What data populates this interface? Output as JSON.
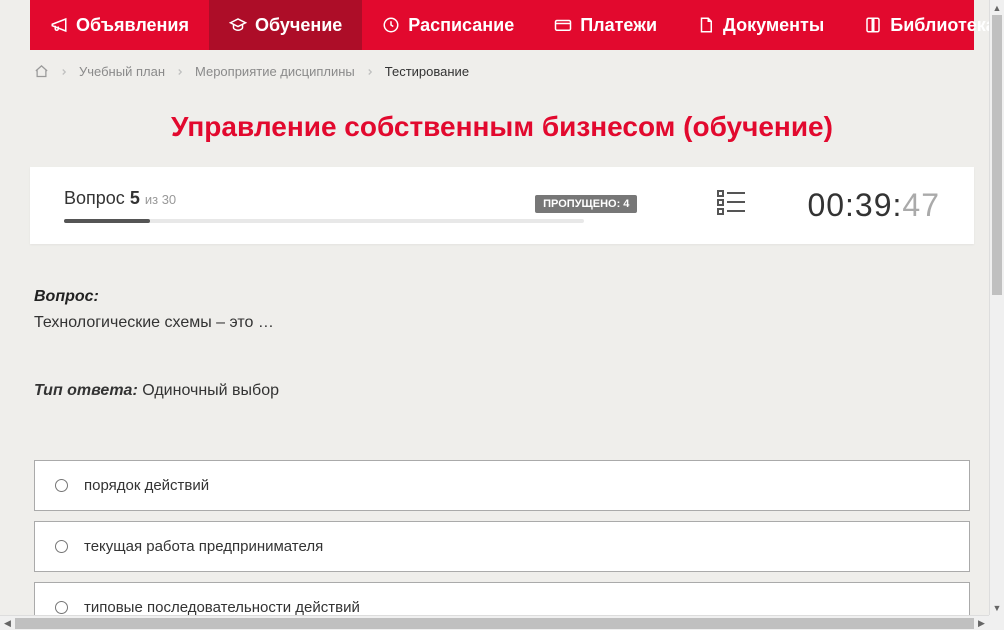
{
  "nav": {
    "items": [
      {
        "label": "Объявления",
        "icon": "megaphone-icon"
      },
      {
        "label": "Обучение",
        "icon": "graduation-icon",
        "active": true
      },
      {
        "label": "Расписание",
        "icon": "clock-icon"
      },
      {
        "label": "Платежи",
        "icon": "card-icon"
      },
      {
        "label": "Документы",
        "icon": "document-icon"
      },
      {
        "label": "Библиотека",
        "icon": "book-icon",
        "dropdown": true
      }
    ]
  },
  "breadcrumb": {
    "items": [
      {
        "label": "Учебный план"
      },
      {
        "label": "Мероприятие дисциплины"
      }
    ],
    "current": "Тестирование"
  },
  "page_title": "Управление собственным бизнесом (обучение)",
  "progress": {
    "question_word": "Вопрос",
    "current": "5",
    "of_word": "из",
    "total": "30",
    "skipped_label": "ПРОПУЩЕНО: 4"
  },
  "timer": {
    "mm": "00",
    "ss": "39",
    "cs": "47"
  },
  "question": {
    "label": "Вопрос:",
    "text": "Технологические схемы – это …",
    "answer_type_label": "Тип ответа:",
    "answer_type": "Одиночный выбор"
  },
  "answers": [
    {
      "text": "порядок действий"
    },
    {
      "text": "текущая работа предпринимателя"
    },
    {
      "text": "типовые последовательности действий"
    }
  ]
}
